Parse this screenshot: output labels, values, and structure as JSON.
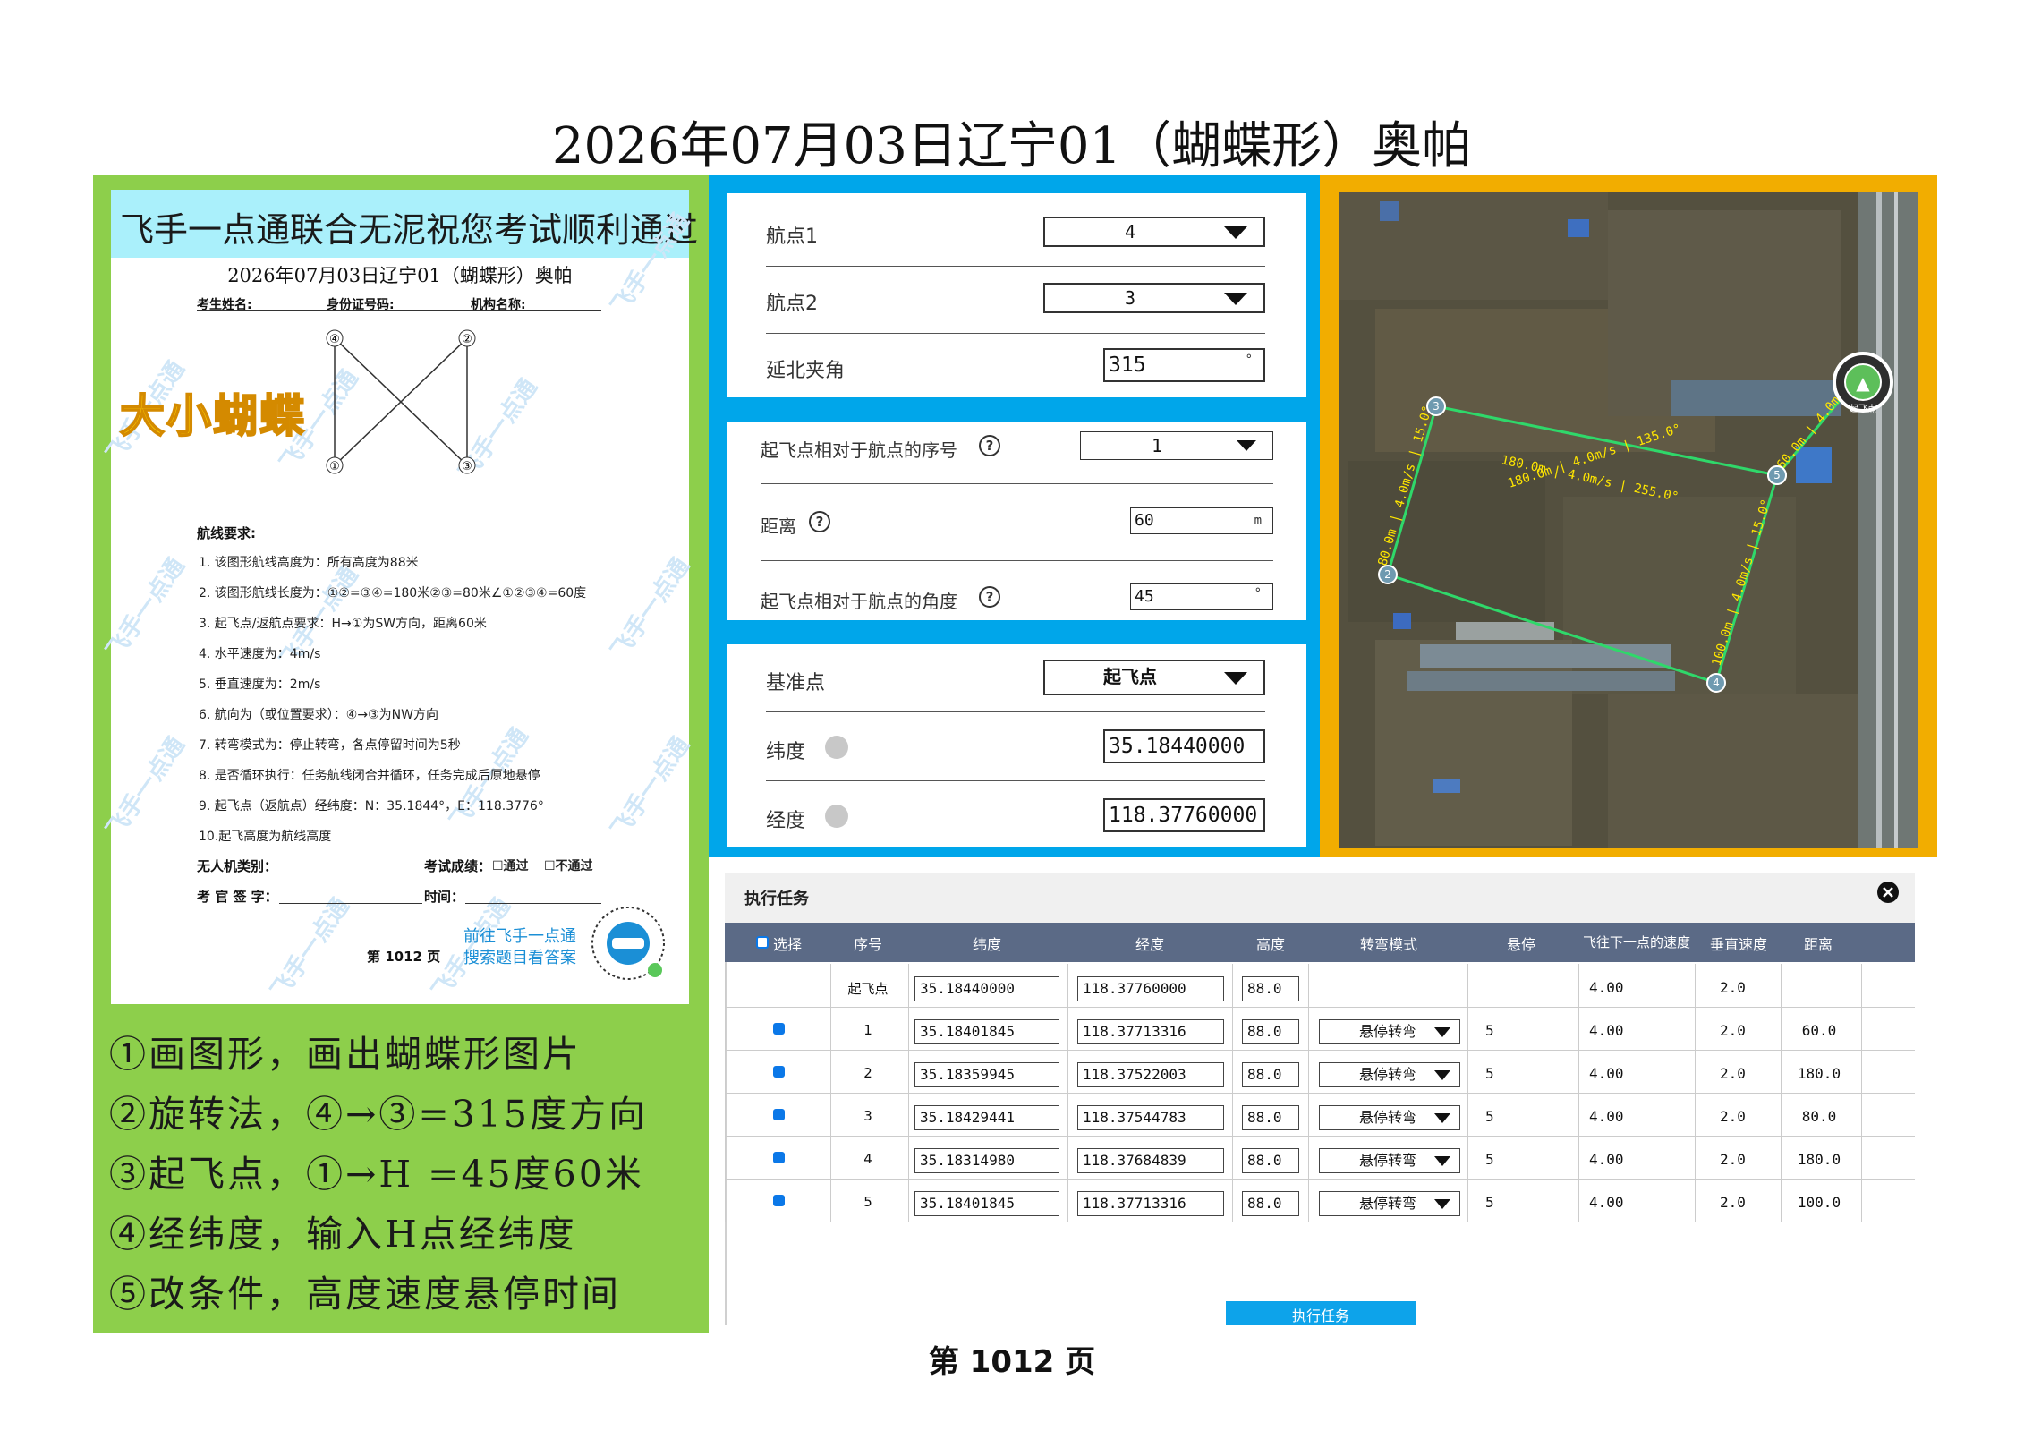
{
  "page_title": "2026年07月03日辽宁01（蝴蝶形）奥帕",
  "page_footer": "第  1012  页",
  "exam_sheet": {
    "banner": "飞手一点通联合无泥祝您考试顺利通过",
    "title": "2026年07月03日辽宁01（蝴蝶形）奥帕",
    "form_name": "考生姓名:",
    "form_id": "身份证号码:",
    "form_org": "机构名称:",
    "big_label": "大小蝴蝶",
    "watermark": "飞手一点通",
    "diagram_points": [
      "④",
      "②",
      "①",
      "③"
    ],
    "req_title": "航线要求:",
    "requirements": [
      "1.  该图形航线高度为：所有高度为88米",
      "2.  该图形航线长度为：①②=③④=180米②③=80米∠①②③④=60度",
      "3.  起飞点/返航点要求：H→①为SW方向，距离60米",
      "4.  水平速度为：4m/s",
      "5.  垂直速度为：2m/s",
      "6.  航向为（或位置要求）：④→③为NW方向",
      "7.  转弯模式为：停止转弯，各点停留时间为5秒",
      "8.  是否循环执行：任务航线闭合并循环，任务完成后原地悬停",
      "9.  起飞点（返航点）经纬度：N：35.1844°，E：118.3776°",
      "10.起飞高度为航线高度"
    ],
    "uav_type": "无人机类别：",
    "result": "考试成绩：",
    "pass": "☐通过",
    "fail": "☐不通过",
    "examiner": "考 官 签 字：",
    "time": "时间：",
    "page": "第  1012  页",
    "qr_line1": "前往飞手一点通",
    "qr_line2": "搜索题目看答案"
  },
  "steps": [
    "①画图形，画出蝴蝶形图片",
    "②旋转法，④→③=315度方向",
    "③起飞点，①→H =45度60米",
    "④经纬度，输入H点经纬度",
    "⑤改条件，高度速度悬停时间"
  ],
  "settings": {
    "waypoint1_label": "航点1",
    "waypoint1_value": "4",
    "waypoint2_label": "航点2",
    "waypoint2_value": "3",
    "north_angle_label": "延北夹角",
    "north_angle_value": "315",
    "degree_unit": "°",
    "takeoff_seq_label": "起飞点相对于航点的序号",
    "takeoff_seq_value": "1",
    "distance_label": "距离",
    "distance_value": "60",
    "distance_unit": "m",
    "takeoff_angle_label": "起飞点相对于航点的角度",
    "takeoff_angle_value": "45",
    "reference_label": "基准点",
    "reference_value": "起飞点",
    "lat_label": "纬度",
    "lat_value": "35.18440000",
    "lon_label": "经度",
    "lon_value": "118.37760000",
    "help_glyph": "?"
  },
  "map": {
    "waypoints": [
      "1",
      "2",
      "3",
      "4",
      "5"
    ],
    "seg_labels": [
      "80.0m | 4.0m/s | 15.0°",
      "180.0m | 4.0m/s | 255.0°",
      "180.0m | 4.0m/s | 135.0°",
      "100.0m | 4.0m/s | 15.0°",
      "60.0m | 4.0m/s"
    ],
    "takeoff_glyph": "▲",
    "takeoff_label": "起飞点",
    "colors": {
      "route": "#2fd86a",
      "label": "#ffe600",
      "satellite": "#4f4a3c"
    }
  },
  "task": {
    "title": "执行任务",
    "close_icon": "close-icon",
    "headers": [
      "选择",
      "序号",
      "纬度",
      "经度",
      "高度",
      "转弯模式",
      "悬停",
      "飞往下一点的速度",
      "垂直速度",
      "距离"
    ],
    "rows": [
      {
        "seq": "起飞点",
        "lat": "35.18440000",
        "lon": "118.37760000",
        "alt": "88.0",
        "mode": "",
        "hover": "",
        "speed": "4.00",
        "vspeed": "2.0",
        "dist": ""
      },
      {
        "seq": "1",
        "lat": "35.18401845",
        "lon": "118.37713316",
        "alt": "88.0",
        "mode": "悬停转弯",
        "hover": "5",
        "speed": "4.00",
        "vspeed": "2.0",
        "dist": "60.0"
      },
      {
        "seq": "2",
        "lat": "35.18359945",
        "lon": "118.37522003",
        "alt": "88.0",
        "mode": "悬停转弯",
        "hover": "5",
        "speed": "4.00",
        "vspeed": "2.0",
        "dist": "180.0"
      },
      {
        "seq": "3",
        "lat": "35.18429441",
        "lon": "118.37544783",
        "alt": "88.0",
        "mode": "悬停转弯",
        "hover": "5",
        "speed": "4.00",
        "vspeed": "2.0",
        "dist": "80.0"
      },
      {
        "seq": "4",
        "lat": "35.18314980",
        "lon": "118.37684839",
        "alt": "88.0",
        "mode": "悬停转弯",
        "hover": "5",
        "speed": "4.00",
        "vspeed": "2.0",
        "dist": "180.0"
      },
      {
        "seq": "5",
        "lat": "35.18401845",
        "lon": "118.37713316",
        "alt": "88.0",
        "mode": "悬停转弯",
        "hover": "5",
        "speed": "4.00",
        "vspeed": "2.0",
        "dist": "100.0"
      }
    ],
    "execute_button": "执行任务"
  }
}
